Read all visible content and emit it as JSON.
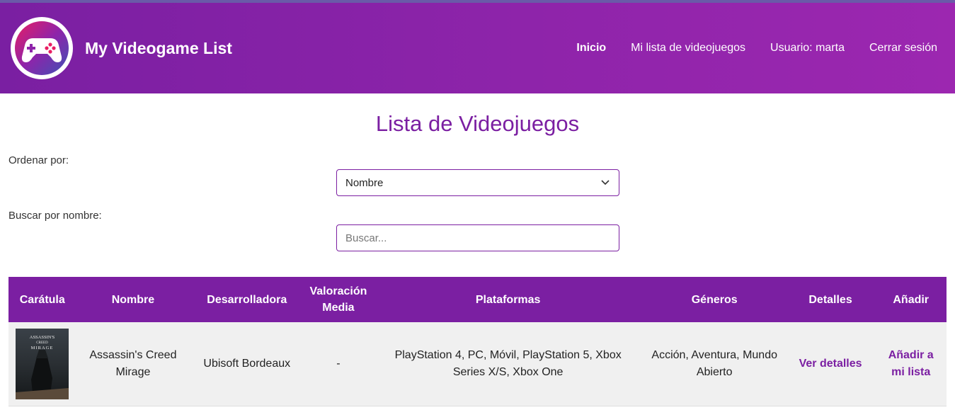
{
  "header": {
    "brand": "My Videogame List",
    "nav": [
      {
        "label": "Inicio",
        "active": true
      },
      {
        "label": "Mi lista de videojuegos",
        "active": false
      },
      {
        "label": "Usuario: marta",
        "active": false
      },
      {
        "label": "Cerrar sesión",
        "active": false
      }
    ]
  },
  "page": {
    "title": "Lista de Videojuegos"
  },
  "filters": {
    "sort_label": "Ordenar por:",
    "sort_value": "Nombre",
    "search_label": "Buscar por nombre:",
    "search_placeholder": "Buscar...",
    "search_value": ""
  },
  "table": {
    "headers": [
      "Carátula",
      "Nombre",
      "Desarrolladora",
      "Valoración Media",
      "Plataformas",
      "Géneros",
      "Detalles",
      "Añadir"
    ],
    "rows": [
      {
        "cover_text": "ASSASSIN'S CREED MIRAGE",
        "name": "Assassin's Creed Mirage",
        "developer": "Ubisoft Bordeaux",
        "rating": "-",
        "platforms": "PlayStation 4, PC, Móvil, PlayStation 5, Xbox Series X/S, Xbox One",
        "genres": "Acción, Aventura, Mundo Abierto",
        "details_link": "Ver detalles",
        "add_link": "Añadir a mi lista"
      }
    ]
  },
  "colors": {
    "accent": "#7b1fa2",
    "header_gradient_start": "#7a1fa2",
    "header_gradient_end": "#9c27b0",
    "row_background": "#f0f0f0"
  },
  "icons": {
    "logo": "gamepad-icon",
    "select": "chevron-down-icon"
  }
}
